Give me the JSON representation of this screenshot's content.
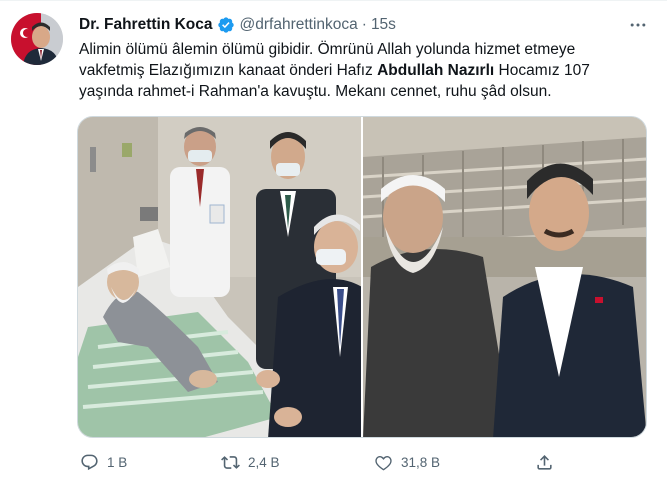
{
  "author": {
    "display_name": "Dr. Fahrettin Koca",
    "handle": "@drfahrettinkoca",
    "separator": "·",
    "timestamp": "15s",
    "verified": true
  },
  "tweet": {
    "text_before": "Alimin ölümü âlemin ölümü gibidir. Ömrünü Allah yolunda hizmet etmeye vakfetmiş Elazığımızın kanaat önderi Hafız ",
    "text_bold": "Abdullah Nazırlı",
    "text_after": " Hocamız 107 yaşında rahmet-i Rahman'a kavuştu. Mekanı cennet, ruhu şâd olsun."
  },
  "actions": {
    "reply_count": "1 B",
    "retweet_count": "2,4 B",
    "like_count": "31,8 B"
  },
  "icons": {
    "more": "more-dots-icon",
    "verified": "verified-badge-icon",
    "reply": "reply-icon",
    "retweet": "retweet-icon",
    "like": "heart-icon",
    "share": "share-icon"
  },
  "colors": {
    "text_primary": "#0f1419",
    "text_secondary": "#536471",
    "verified_blue": "#1d9bf0",
    "border": "#cfd9de"
  }
}
